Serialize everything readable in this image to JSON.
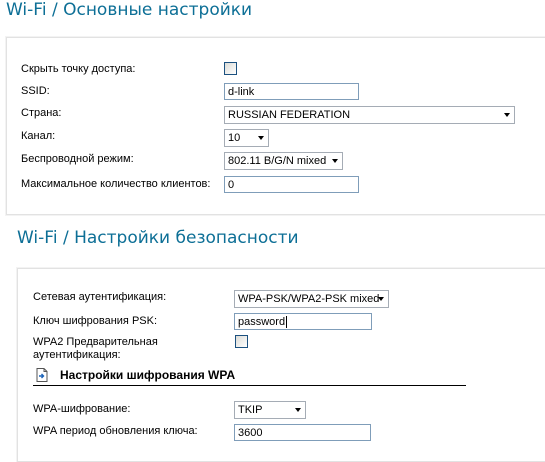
{
  "basic": {
    "title": "Wi-Fi  / Основные настройки",
    "hide_ap_label": "Скрыть точку доступа:",
    "ssid_label": "SSID:",
    "ssid_value": "d-link",
    "country_label": "Страна:",
    "country_value": "RUSSIAN FEDERATION",
    "channel_label": "Канал:",
    "channel_value": "10",
    "mode_label": "Беспроводной режим:",
    "mode_value": "802.11 B/G/N mixed",
    "max_clients_label": "Максимальное количество клиентов:",
    "max_clients_value": "0"
  },
  "security": {
    "title": "Wi-Fi  / Настройки безопасности",
    "auth_label": "Сетевая аутентификация:",
    "auth_value": "WPA-PSK/WPA2-PSK mixed",
    "psk_label": "Ключ шифрования PSK:",
    "psk_value": "password",
    "preauth_label_line1": "WPA2 Предварительная",
    "preauth_label_line2": "аутентификация:",
    "wpa_header": "Настройки шифрования WPA",
    "wpa_enc_label": "WPA-шифрование:",
    "wpa_enc_value": "TKIP",
    "rekey_label": "WPA период обновления ключа:",
    "rekey_value": "3600"
  }
}
